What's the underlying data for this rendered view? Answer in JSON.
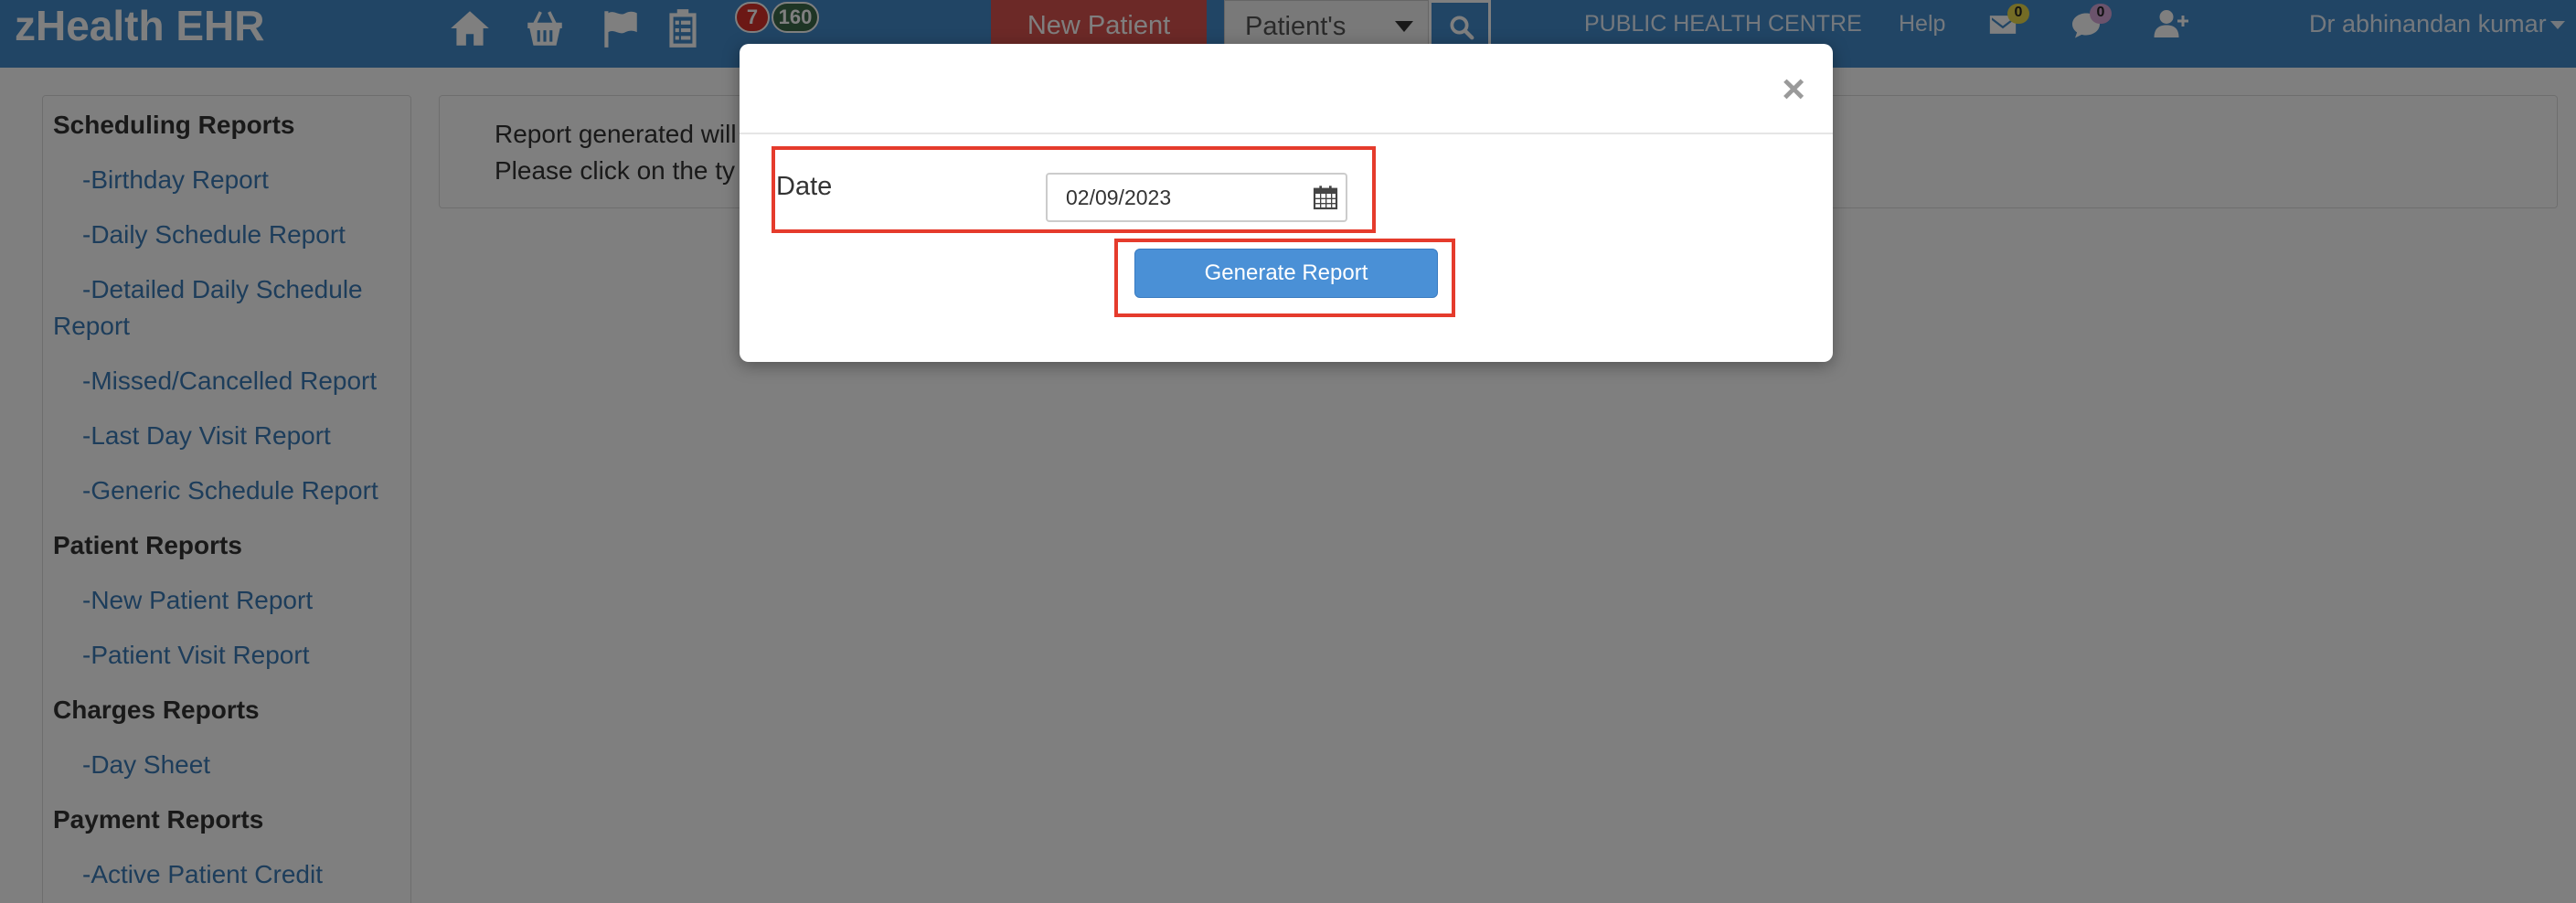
{
  "navbar": {
    "brand": "zHealth EHR",
    "icons": [
      "home-icon",
      "basket-icon",
      "flag-icon",
      "clipboard-icon"
    ],
    "badge_red": "7",
    "badge_dark": "160",
    "new_patient_label": "New Patient",
    "search_select_value": "Patient's",
    "centre_link": "PUBLIC HEALTH CENTRE",
    "help_link": "Help",
    "mail_count": "0",
    "chat_count": "0",
    "user_name": "Dr abhinandan kumar",
    "colors": {
      "navbar_bg": "#428bca",
      "new_patient_bg": "#d9534f"
    }
  },
  "sidebar": {
    "sections": [
      {
        "title": "Scheduling Reports",
        "items": [
          "-Birthday Report",
          "-Daily Schedule Report",
          "-Detailed Daily Schedule Report",
          "-Missed/Cancelled Report",
          "-Last Day Visit Report",
          "-Generic Schedule Report"
        ]
      },
      {
        "title": "Patient Reports",
        "items": [
          "-New Patient Report",
          "-Patient Visit Report"
        ]
      },
      {
        "title": "Charges Reports",
        "items": [
          "-Day Sheet"
        ]
      },
      {
        "title": "Payment Reports",
        "items": [
          "-Active Patient Credit"
        ]
      }
    ]
  },
  "main": {
    "info_line_1": "Report generated will",
    "info_line_2": "Please click on the ty"
  },
  "modal": {
    "close_label": "×",
    "date_label": "Date",
    "date_value": "02/09/2023",
    "generate_label": "Generate Report",
    "highlight_color": "#e53b2c"
  }
}
